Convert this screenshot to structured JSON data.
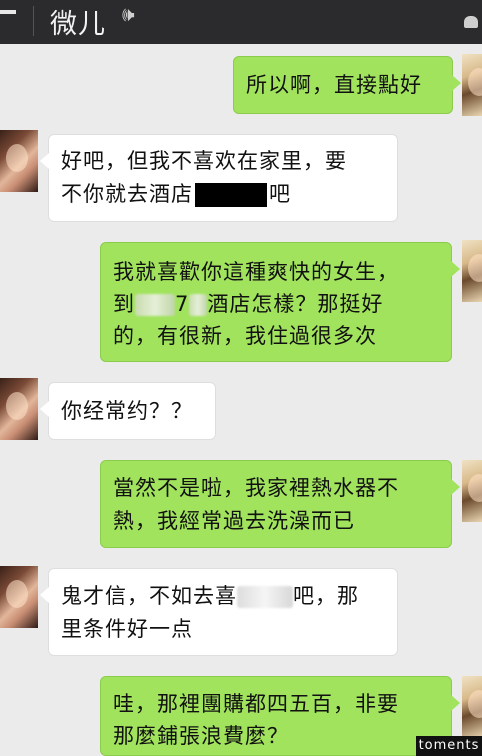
{
  "header": {
    "title": "微儿",
    "speaker_glyph": "@"
  },
  "messages": [
    {
      "side": "out",
      "text": "所以啊，直接點好"
    },
    {
      "side": "in",
      "line1": "好吧，但我不喜欢在家里，要",
      "line2a": "不你就去酒店",
      "line2b": "吧"
    },
    {
      "side": "out",
      "line1": "我就喜歡你這種爽快的女生，",
      "line2a": "到",
      "line2b": "7",
      "line2c": "酒店怎樣？那挺好",
      "line3": "的，有很新，我住過很多次"
    },
    {
      "side": "in",
      "text": "你经常约？？"
    },
    {
      "side": "out",
      "line1": "當然不是啦，我家裡熱水器不",
      "line2": "熱，我經常過去洗澡而已"
    },
    {
      "side": "in",
      "line1a": "鬼才信，不如去喜",
      "line1b": "吧，那",
      "line2": "里条件好一点"
    },
    {
      "side": "out",
      "line1": "哇，那裡團購都四五百，非要",
      "line2": "那麼鋪張浪費麼？"
    }
  ],
  "watermark": "toments"
}
